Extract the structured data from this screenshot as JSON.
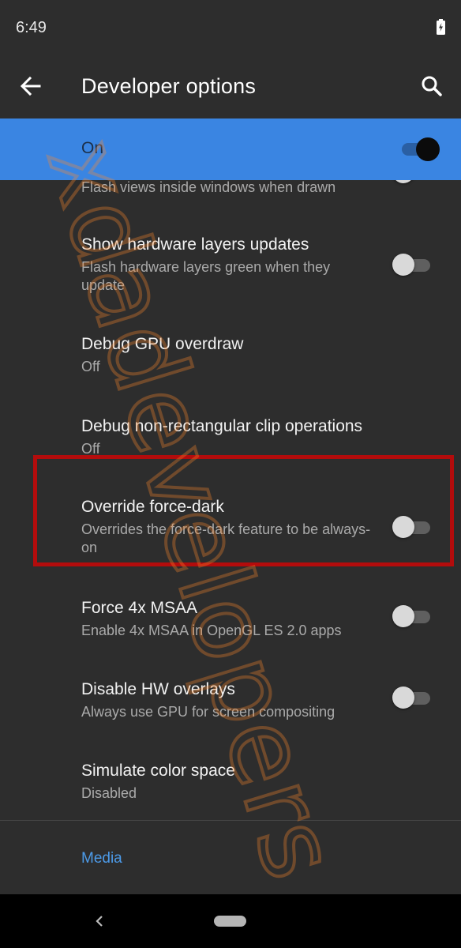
{
  "status_bar": {
    "time": "6:49",
    "battery_icon": "battery-charging-icon"
  },
  "app_bar": {
    "back_icon": "arrow-back-icon",
    "title": "Developer options",
    "search_icon": "search-icon"
  },
  "master_switch": {
    "label": "On",
    "enabled": true,
    "accent_color": "#3a85e2"
  },
  "settings": [
    {
      "title": "",
      "summary": "Flash views inside windows when drawn",
      "has_toggle": true,
      "checked": false
    },
    {
      "title": "Show hardware layers updates",
      "summary": "Flash hardware layers green when they update",
      "has_toggle": true,
      "checked": false
    },
    {
      "title": "Debug GPU overdraw",
      "summary": "Off",
      "has_toggle": false
    },
    {
      "title": "Debug non-rectangular clip operations",
      "summary": "Off",
      "has_toggle": false
    },
    {
      "title": "Override force-dark",
      "summary": "Overrides the force-dark feature to be always-on",
      "has_toggle": true,
      "checked": false,
      "highlighted": true
    },
    {
      "title": "Force 4x MSAA",
      "summary": "Enable 4x MSAA in OpenGL ES 2.0 apps",
      "has_toggle": true,
      "checked": false
    },
    {
      "title": "Disable HW overlays",
      "summary": "Always use GPU for screen compositing",
      "has_toggle": true,
      "checked": false
    },
    {
      "title": "Simulate color space",
      "summary": "Disabled",
      "has_toggle": false
    }
  ],
  "section_header": {
    "label": "Media",
    "color": "#4c9ae8"
  },
  "highlight_color": "#b30c0c",
  "watermark": {
    "text": "xdadevelopers"
  },
  "navigation_bar": {
    "back_icon": "nav-back-icon",
    "home_icon": "home-pill-icon"
  }
}
